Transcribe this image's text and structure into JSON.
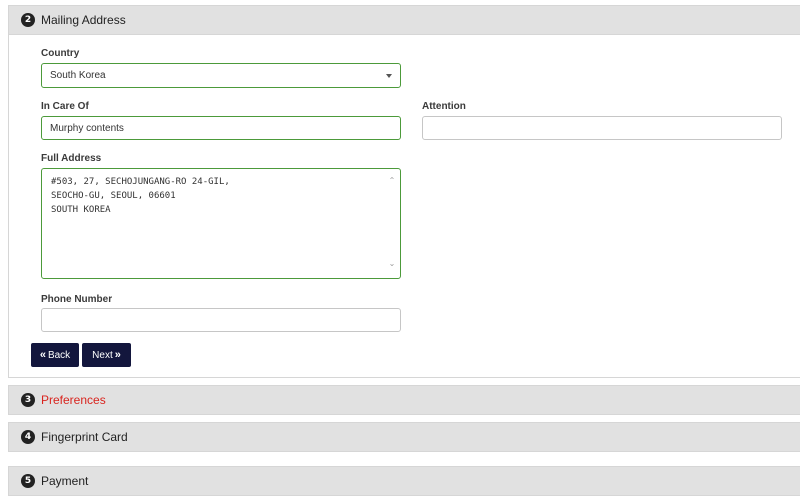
{
  "sections": [
    {
      "number": "2",
      "title": "Mailing Address"
    },
    {
      "number": "3",
      "title": "Preferences"
    },
    {
      "number": "4",
      "title": "Fingerprint Card"
    },
    {
      "number": "5",
      "title": "Payment"
    }
  ],
  "form": {
    "country": {
      "label": "Country",
      "value": "South Korea"
    },
    "in_care_of": {
      "label": "In Care Of",
      "value": "Murphy contents"
    },
    "attention": {
      "label": "Attention",
      "value": ""
    },
    "full_address": {
      "label": "Full Address",
      "lines": [
        "#503, 27, SECHOJUNGANG-RO 24-GIL,",
        "SEOCHO-GU, SEOUL, 06601",
        "SOUTH KOREA"
      ]
    },
    "phone_number": {
      "label": "Phone Number",
      "value": ""
    }
  },
  "buttons": {
    "back_label": "Back",
    "back_icon": "double-chevron-left",
    "next_label": "Next",
    "next_icon": "double-chevron-right"
  },
  "colors": {
    "button_bg": "#13163d",
    "valid_border": "#4c9a3a",
    "active_section": "#d9241e",
    "header_bg": "#e1e1e1"
  }
}
